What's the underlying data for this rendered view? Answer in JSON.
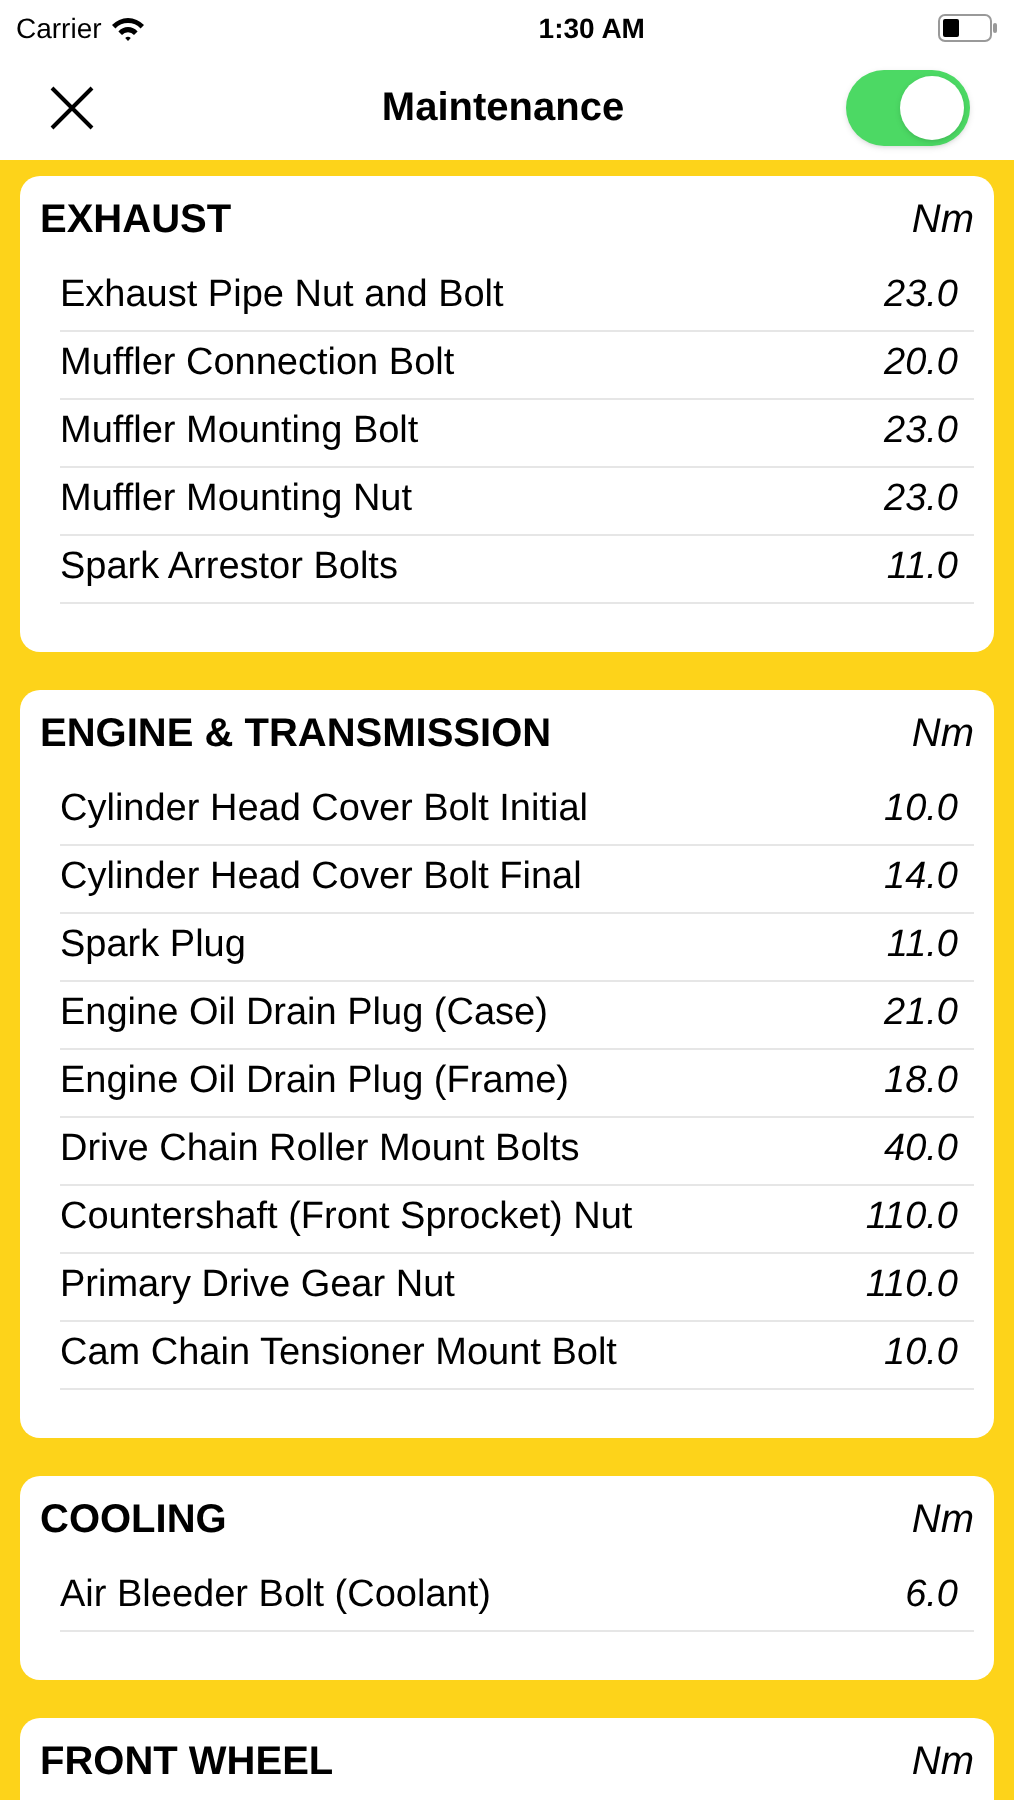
{
  "status_bar": {
    "carrier": "Carrier",
    "time": "1:30 AM"
  },
  "nav": {
    "title": "Maintenance",
    "toggle_on": true
  },
  "sections": [
    {
      "title": "EXHAUST",
      "unit": "Nm",
      "rows": [
        {
          "label": "Exhaust Pipe Nut and Bolt",
          "value": "23.0"
        },
        {
          "label": "Muffler Connection Bolt",
          "value": "20.0"
        },
        {
          "label": "Muffler Mounting Bolt",
          "value": "23.0"
        },
        {
          "label": "Muffler Mounting Nut",
          "value": "23.0"
        },
        {
          "label": "Spark Arrestor Bolts",
          "value": "11.0"
        }
      ]
    },
    {
      "title": "ENGINE & TRANSMISSION",
      "unit": "Nm",
      "rows": [
        {
          "label": "Cylinder Head Cover Bolt Initial",
          "value": "10.0"
        },
        {
          "label": "Cylinder Head Cover Bolt Final",
          "value": "14.0"
        },
        {
          "label": "Spark Plug",
          "value": "11.0"
        },
        {
          "label": "Engine Oil Drain Plug (Case)",
          "value": "21.0"
        },
        {
          "label": "Engine Oil Drain Plug (Frame)",
          "value": "18.0"
        },
        {
          "label": "Drive Chain Roller Mount Bolts",
          "value": "40.0"
        },
        {
          "label": "Countershaft (Front Sprocket) Nut",
          "value": "110.0"
        },
        {
          "label": "Primary Drive Gear Nut",
          "value": "110.0"
        },
        {
          "label": "Cam Chain Tensioner Mount Bolt",
          "value": "10.0"
        }
      ]
    },
    {
      "title": "COOLING",
      "unit": "Nm",
      "rows": [
        {
          "label": "Air Bleeder Bolt (Coolant)",
          "value": "6.0"
        }
      ]
    },
    {
      "title": "FRONT WHEEL",
      "unit": "Nm"
    }
  ]
}
